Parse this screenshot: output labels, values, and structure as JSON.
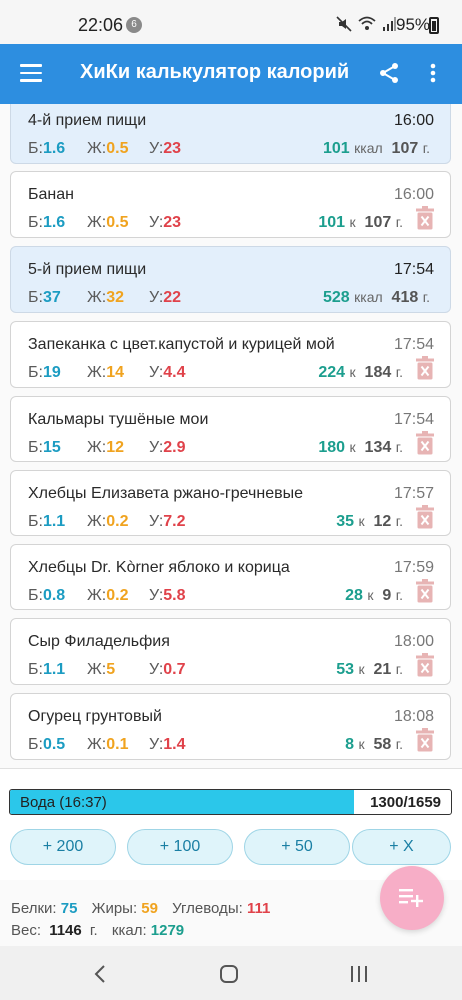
{
  "status_bar": {
    "time": "22:06",
    "notification_count": "6",
    "battery": "95%"
  },
  "app_bar": {
    "title": "ХиКи калькулятор калорий"
  },
  "macro_labels": {
    "b": "Б:",
    "z": "Ж:",
    "u": "У:",
    "kcal_full": "ккал",
    "kcal_short": "к",
    "gram": "г."
  },
  "entries": [
    {
      "type": "meal",
      "name": "4-й прием пищи",
      "time": "16:00",
      "b": "1.6",
      "z": "0.5",
      "u": "23",
      "kcal": "101",
      "gram": "107"
    },
    {
      "type": "item",
      "name": "Банан",
      "time": "16:00",
      "b": "1.6",
      "z": "0.5",
      "u": "23",
      "kcal": "101",
      "gram": "107"
    },
    {
      "type": "meal",
      "name": "5-й прием пищи",
      "time": "17:54",
      "b": "37",
      "z": "32",
      "u": "22",
      "kcal": "528",
      "gram": "418"
    },
    {
      "type": "item",
      "name": "Запеканка с цвет.капустой и курицей мой",
      "time": "17:54",
      "b": "19",
      "z": "14",
      "u": "4.4",
      "kcal": "224",
      "gram": "184"
    },
    {
      "type": "item",
      "name": "Кальмары тушёные мои",
      "time": "17:54",
      "b": "15",
      "z": "12",
      "u": "2.9",
      "kcal": "180",
      "gram": "134"
    },
    {
      "type": "item",
      "name": "Хлебцы Елизавета ржано-гречневые",
      "time": "17:57",
      "b": "1.1",
      "z": "0.2",
      "u": "7.2",
      "kcal": "35",
      "gram": "12"
    },
    {
      "type": "item",
      "name": "Хлебцы Dr. Kòrner яблоко и корица",
      "time": "17:59",
      "b": "0.8",
      "z": "0.2",
      "u": "5.8",
      "kcal": "28",
      "gram": "9"
    },
    {
      "type": "item",
      "name": "Сыр Филадельфия",
      "time": "18:00",
      "b": "1.1",
      "z": "5",
      "u": "0.7",
      "kcal": "53",
      "gram": "21"
    },
    {
      "type": "item",
      "name": "Огурец грунтовый",
      "time": "18:08",
      "b": "0.5",
      "z": "0.1",
      "u": "1.4",
      "kcal": "8",
      "gram": "58"
    }
  ],
  "water": {
    "label": "Вода (16:37)",
    "value": "1300/1659",
    "fill_fraction": 0.78
  },
  "water_buttons": [
    "+ 200",
    "+ 100",
    "+ 50",
    "+ X"
  ],
  "summary": {
    "protein_label": "Белки:",
    "protein": "75",
    "fat_label": "Жиры:",
    "fat": "59",
    "carbs_label": "Углеводы:",
    "carbs": "111",
    "weight_label": "Вес:",
    "weight": "1146",
    "weight_unit": "г.",
    "kcal_label": "ккал:",
    "kcal": "1279"
  },
  "colors": {
    "appbar": "#2d8ee0",
    "protein": "#1c9cc2",
    "fat": "#f0a31f",
    "carbs": "#e0424a",
    "kcal": "#1c9e8e",
    "water": "#2bc7ea",
    "fab": "#f7aec7",
    "meal_bg": "#e3effb"
  }
}
